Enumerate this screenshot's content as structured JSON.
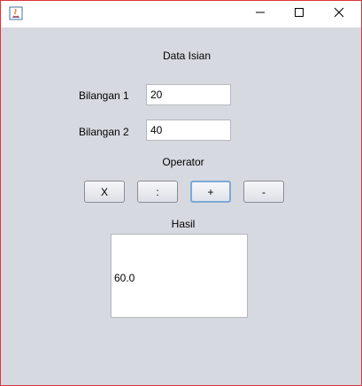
{
  "window": {
    "controls": {
      "minimize_icon": "minimize-icon",
      "maximize_icon": "maximize-icon",
      "close_icon": "close-icon"
    }
  },
  "form": {
    "heading": "Data Isian",
    "bilangan1_label": "Bilangan 1",
    "bilangan1_value": "20",
    "bilangan2_label": "Bilangan 2",
    "bilangan2_value": "40",
    "operator_label": "Operator",
    "operators": [
      "X",
      ":",
      "+",
      "-"
    ],
    "focused_operator": "+",
    "result_label": "Hasil",
    "result_value": "60.0"
  },
  "colors": {
    "window_bg": "#d6d9df",
    "border": "#d9363b",
    "focus": "#7ea7d8"
  }
}
